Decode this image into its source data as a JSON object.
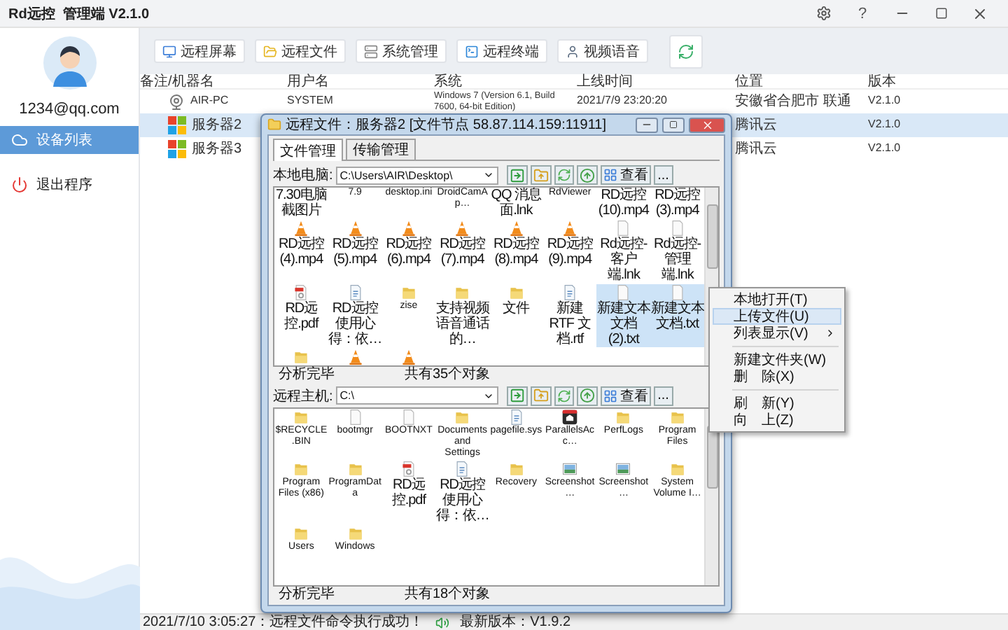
{
  "window": {
    "title": "Rd远控  管理端 V2.1.0",
    "help": "?"
  },
  "sidebar": {
    "email": "1234@qq.com",
    "items": [
      {
        "label": "设备列表",
        "kind": "devices",
        "selected": true
      },
      {
        "label": "退出程序",
        "kind": "exit",
        "selected": false
      }
    ]
  },
  "toolbar": {
    "buttons": [
      {
        "label": "远程屏幕",
        "kind": "screen"
      },
      {
        "label": "远程文件",
        "kind": "files"
      },
      {
        "label": "系统管理",
        "kind": "system"
      },
      {
        "label": "远程终端",
        "kind": "terminal"
      },
      {
        "label": "视频语音",
        "kind": "video"
      },
      {
        "kind": "refresh"
      }
    ]
  },
  "table": {
    "columns": [
      "备注/机器名",
      "用户名",
      "系统",
      "上线时间",
      "位置",
      "版本"
    ],
    "rows": [
      {
        "kind": "webcam",
        "name": "AIR-PC",
        "user": "SYSTEM",
        "system": "Windows 7 (Version 6.1, Build 7600, 64-bit Edition)",
        "time": "2021/7/9 23:20:20",
        "location": "安徽省合肥市 联通",
        "version": "V2.1.0",
        "selected": false
      },
      {
        "kind": "windows",
        "name": "服务器2",
        "location": "腾讯云",
        "version": "V2.1.0",
        "selected": true
      },
      {
        "kind": "windows",
        "name": "服务器3",
        "location": "腾讯云",
        "version": "V2.1.0",
        "selected": false
      }
    ]
  },
  "file_dialog": {
    "title": "远程文件：服务器2 [文件节点 58.87.114.159:11911]",
    "tabs": [
      {
        "label": "文件管理",
        "selected": true
      },
      {
        "label": "传输管理",
        "selected": false
      }
    ],
    "panes": [
      {
        "label": "本地电脑:",
        "path": "C:\\Users\\AIR\\Desktop\\",
        "view": "查看",
        "more": "...",
        "status": "分析完毕",
        "count": "共有35个对象",
        "files": [
          {
            "name": "7.30电脑截图片",
            "selected": false
          },
          {
            "name": "7.9",
            "selected": false
          },
          {
            "name": "desktop.ini",
            "selected": false
          },
          {
            "name": "DroidCamAp…",
            "selected": false
          },
          {
            "name": "QQ 消息面.lnk",
            "selected": false
          },
          {
            "name": "RdViewer",
            "selected": false
          },
          {
            "name": "RD远控(10).mp4",
            "selected": false
          },
          {
            "name": "RD远控(3).mp4",
            "selected": false
          },
          {
            "name": "RD远控(4).mp4",
            "kind": "cone",
            "selected": false
          },
          {
            "name": "RD远控(5).mp4",
            "kind": "cone",
            "selected": false
          },
          {
            "name": "RD远控(6).mp4",
            "kind": "cone",
            "selected": false
          },
          {
            "name": "RD远控(7).mp4",
            "kind": "cone",
            "selected": false
          },
          {
            "name": "RD远控(8).mp4",
            "kind": "cone",
            "selected": false
          },
          {
            "name": "RD远控(9).mp4",
            "kind": "cone",
            "selected": false
          },
          {
            "name": "Rd远控-客户端.lnk",
            "kind": "doc",
            "selected": false
          },
          {
            "name": "Rd远控-管理端.lnk",
            "kind": "doc",
            "selected": false
          },
          {
            "name": "RD远控.pdf",
            "kind": "pdf",
            "selected": false
          },
          {
            "name": "RD远控使用心得：依…",
            "kind": "text",
            "selected": false
          },
          {
            "name": "zise",
            "kind": "folder",
            "selected": false
          },
          {
            "name": "支持视频语音通话的…",
            "kind": "folder",
            "selected": false
          },
          {
            "name": "文件",
            "kind": "folder",
            "selected": false
          },
          {
            "name": "新建 RTF 文档.rtf",
            "kind": "text",
            "selected": false
          },
          {
            "name": "新建文本文档 (2).txt",
            "kind": "doc",
            "selected": true
          },
          {
            "name": "新建文本文档.txt",
            "kind": "doc",
            "selected": true
          },
          {
            "kind": "folder",
            "selected": false
          },
          {
            "kind": "cone",
            "selected": false
          },
          {
            "kind": "cone",
            "selected": false
          }
        ]
      },
      {
        "label": "远程主机:",
        "path": "C:\\",
        "view": "查看",
        "more": "...",
        "status": "分析完毕",
        "count": "共有18个对象",
        "files": [
          {
            "name": "$RECYCLE.BIN",
            "kind": "folder",
            "selected": false
          },
          {
            "name": "bootmgr",
            "kind": "doc",
            "selected": false
          },
          {
            "name": "BOOTNXT",
            "kind": "doc",
            "selected": false
          },
          {
            "name": "Documents and Settings",
            "kind": "folder",
            "selected": false
          },
          {
            "name": "pagefile.sys",
            "kind": "text",
            "selected": false
          },
          {
            "name": "ParallelsAcc…",
            "kind": "app",
            "selected": false
          },
          {
            "name": "PerfLogs",
            "kind": "folder",
            "selected": false
          },
          {
            "name": "Program Files",
            "kind": "folder",
            "selected": false
          },
          {
            "name": "Program Files (x86)",
            "kind": "folder",
            "selected": false
          },
          {
            "name": "ProgramData",
            "kind": "folder",
            "selected": false
          },
          {
            "name": "RD远控.pdf",
            "kind": "pdf",
            "selected": false
          },
          {
            "name": "RD远控使用心得：依…",
            "kind": "text",
            "selected": false
          },
          {
            "name": "Recovery",
            "kind": "folder",
            "selected": false
          },
          {
            "name": "Screenshot…",
            "kind": "image",
            "selected": false
          },
          {
            "name": "Screenshot…",
            "kind": "image",
            "selected": false
          },
          {
            "name": "System Volume I…",
            "kind": "folder",
            "selected": false
          },
          {
            "name": "Users",
            "kind": "folder",
            "selected": false
          },
          {
            "name": "Windows",
            "kind": "folder",
            "selected": false
          }
        ]
      }
    ]
  },
  "context_menu": {
    "items": [
      {
        "kind": "item",
        "label": "本地打开(T)",
        "selected": false,
        "submenu": false
      },
      {
        "kind": "item",
        "label": "上传文件(U)",
        "selected": true,
        "submenu": false
      },
      {
        "kind": "item",
        "label": "列表显示(V)",
        "selected": false,
        "submenu": true
      },
      {
        "kind": "separator"
      },
      {
        "kind": "item",
        "label": "新建文件夹(W)",
        "selected": false,
        "submenu": false
      },
      {
        "kind": "item",
        "label": "删　除(X)",
        "selected": false,
        "submenu": false
      },
      {
        "kind": "separator"
      },
      {
        "kind": "item",
        "label": "刷　新(Y)",
        "selected": false,
        "submenu": false
      },
      {
        "kind": "item",
        "label": "向　上(Z)",
        "selected": false,
        "submenu": false
      }
    ]
  },
  "status_bar": {
    "message": "2021/7/10 3:05:27：远程文件命令执行成功！",
    "version": "最新版本：V1.9.2"
  }
}
